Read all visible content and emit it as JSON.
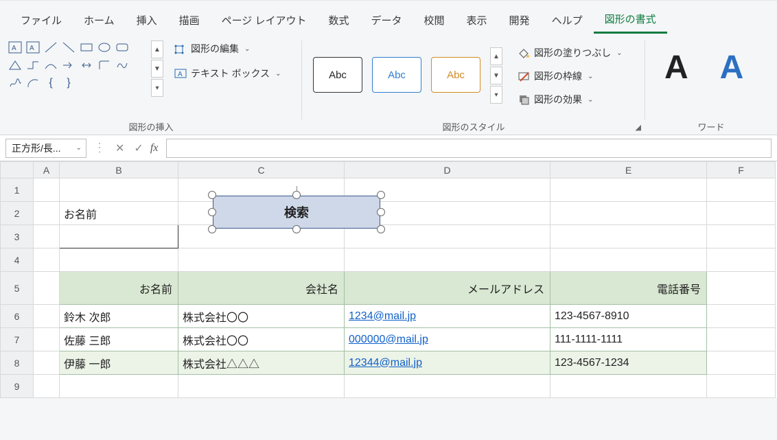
{
  "menu": {
    "tabs": [
      "ファイル",
      "ホーム",
      "挿入",
      "描画",
      "ページ レイアウト",
      "数式",
      "データ",
      "校閲",
      "表示",
      "開発",
      "ヘルプ",
      "図形の書式"
    ],
    "active_index": 11
  },
  "ribbon": {
    "shapes_group_label": "図形の挿入",
    "styles_group_label": "図形のスタイル",
    "word_group_label": "ワード",
    "edit_shape_label": "図形の編集",
    "text_box_label": "テキスト ボックス",
    "shape_fill_label": "図形の塗りつぶし",
    "shape_outline_label": "図形の枠線",
    "shape_effects_label": "図形の効果",
    "style_tile_text": "Abc"
  },
  "formula_bar": {
    "name_box": "正方形/長...",
    "fx_label": "fx",
    "formula_value": ""
  },
  "columns": [
    "A",
    "B",
    "C",
    "D",
    "E",
    "F"
  ],
  "rows": [
    "1",
    "2",
    "3",
    "4",
    "5",
    "6",
    "7",
    "8",
    "9"
  ],
  "cells": {
    "B2": "お名前"
  },
  "shape": {
    "label": "検索"
  },
  "table": {
    "headers": [
      "お名前",
      "会社名",
      "メールアドレス",
      "電話番号"
    ],
    "rows": [
      {
        "name": "鈴木 次郎",
        "company": "株式会社〇〇",
        "mail": "1234@mail.jp",
        "phone": "123-4567-8910"
      },
      {
        "name": "佐藤 三郎",
        "company": "株式会社〇〇",
        "mail": "000000@mail.jp",
        "phone": "111-1111-1111"
      },
      {
        "name": "伊藤 一郎",
        "company": "株式会社△△△",
        "mail": "12344@mail.jp",
        "phone": "123-4567-1234"
      }
    ]
  }
}
